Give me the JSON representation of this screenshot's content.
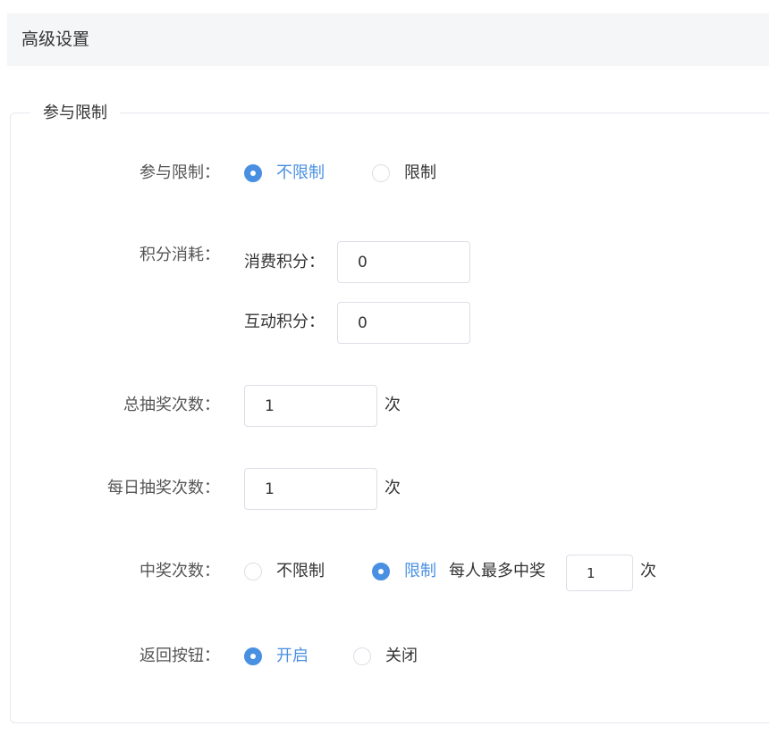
{
  "header": {
    "title": "高级设置"
  },
  "group": {
    "legend": "参与限制"
  },
  "participation": {
    "label": "参与限制：",
    "options": [
      {
        "label": "不限制",
        "checked": true
      },
      {
        "label": "限制",
        "checked": false
      }
    ]
  },
  "points": {
    "label": "积分消耗：",
    "consumption": {
      "label": "消费积分：",
      "value": "0"
    },
    "interaction": {
      "label": "互动积分：",
      "value": "0"
    }
  },
  "total_draws": {
    "label": "总抽奖次数：",
    "value": "1",
    "unit": "次"
  },
  "daily_draws": {
    "label": "每日抽奖次数：",
    "value": "1",
    "unit": "次"
  },
  "win_count": {
    "label": "中奖次数：",
    "options": [
      {
        "label": "不限制",
        "checked": false
      },
      {
        "label": "限制",
        "checked": true
      }
    ],
    "per_person_label": "每人最多中奖",
    "value": "1",
    "unit": "次"
  },
  "back_button": {
    "label": "返回按钮：",
    "options": [
      {
        "label": "开启",
        "checked": true
      },
      {
        "label": "关闭",
        "checked": false
      }
    ]
  },
  "colors": {
    "accent": "#4a90e2",
    "border": "#dcdfe6",
    "header_bg": "#f5f6f7"
  }
}
